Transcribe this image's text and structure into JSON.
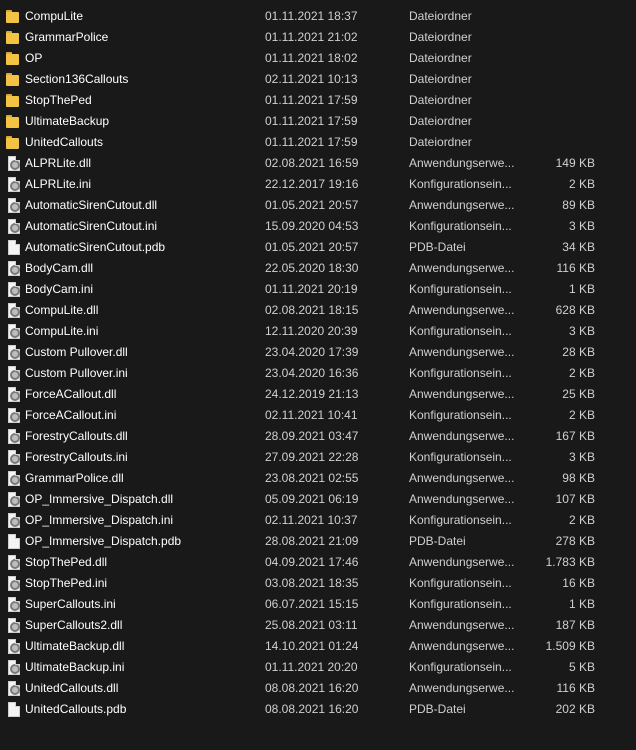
{
  "files": [
    {
      "name": "CompuLite",
      "date": "01.11.2021 18:37",
      "type": "Dateiordner",
      "size": "",
      "icon": "folder-icon"
    },
    {
      "name": "GrammarPolice",
      "date": "01.11.2021 21:02",
      "type": "Dateiordner",
      "size": "",
      "icon": "folder-icon"
    },
    {
      "name": "OP",
      "date": "01.11.2021 18:02",
      "type": "Dateiordner",
      "size": "",
      "icon": "folder-icon"
    },
    {
      "name": "Section136Callouts",
      "date": "02.11.2021 10:13",
      "type": "Dateiordner",
      "size": "",
      "icon": "folder-icon"
    },
    {
      "name": "StopThePed",
      "date": "01.11.2021 17:59",
      "type": "Dateiordner",
      "size": "",
      "icon": "folder-icon"
    },
    {
      "name": "UltimateBackup",
      "date": "01.11.2021 17:59",
      "type": "Dateiordner",
      "size": "",
      "icon": "folder-icon"
    },
    {
      "name": "UnitedCallouts",
      "date": "01.11.2021 17:59",
      "type": "Dateiordner",
      "size": "",
      "icon": "folder-icon"
    },
    {
      "name": "ALPRLite.dll",
      "date": "02.08.2021 16:59",
      "type": "Anwendungserwe...",
      "size": "149 KB",
      "icon": "dll-file-icon"
    },
    {
      "name": "ALPRLite.ini",
      "date": "22.12.2017 19:16",
      "type": "Konfigurationsein...",
      "size": "2 KB",
      "icon": "ini-file-icon"
    },
    {
      "name": "AutomaticSirenCutout.dll",
      "date": "01.05.2021 20:57",
      "type": "Anwendungserwe...",
      "size": "89 KB",
      "icon": "dll-file-icon"
    },
    {
      "name": "AutomaticSirenCutout.ini",
      "date": "15.09.2020 04:53",
      "type": "Konfigurationsein...",
      "size": "3 KB",
      "icon": "ini-file-icon"
    },
    {
      "name": "AutomaticSirenCutout.pdb",
      "date": "01.05.2021 20:57",
      "type": "PDB-Datei",
      "size": "34 KB",
      "icon": "pdb-file-icon"
    },
    {
      "name": "BodyCam.dll",
      "date": "22.05.2020 18:30",
      "type": "Anwendungserwe...",
      "size": "116 KB",
      "icon": "dll-file-icon"
    },
    {
      "name": "BodyCam.ini",
      "date": "01.11.2021 20:19",
      "type": "Konfigurationsein...",
      "size": "1 KB",
      "icon": "ini-file-icon"
    },
    {
      "name": "CompuLite.dll",
      "date": "02.08.2021 18:15",
      "type": "Anwendungserwe...",
      "size": "628 KB",
      "icon": "dll-file-icon"
    },
    {
      "name": "CompuLite.ini",
      "date": "12.11.2020 20:39",
      "type": "Konfigurationsein...",
      "size": "3 KB",
      "icon": "ini-file-icon"
    },
    {
      "name": "Custom Pullover.dll",
      "date": "23.04.2020 17:39",
      "type": "Anwendungserwe...",
      "size": "28 KB",
      "icon": "dll-file-icon"
    },
    {
      "name": "Custom Pullover.ini",
      "date": "23.04.2020 16:36",
      "type": "Konfigurationsein...",
      "size": "2 KB",
      "icon": "ini-file-icon"
    },
    {
      "name": "ForceACallout.dll",
      "date": "24.12.2019 21:13",
      "type": "Anwendungserwe...",
      "size": "25 KB",
      "icon": "dll-file-icon"
    },
    {
      "name": "ForceACallout.ini",
      "date": "02.11.2021 10:41",
      "type": "Konfigurationsein...",
      "size": "2 KB",
      "icon": "ini-file-icon"
    },
    {
      "name": "ForestryCallouts.dll",
      "date": "28.09.2021 03:47",
      "type": "Anwendungserwe...",
      "size": "167 KB",
      "icon": "dll-file-icon"
    },
    {
      "name": "ForestryCallouts.ini",
      "date": "27.09.2021 22:28",
      "type": "Konfigurationsein...",
      "size": "3 KB",
      "icon": "ini-file-icon"
    },
    {
      "name": "GrammarPolice.dll",
      "date": "23.08.2021 02:55",
      "type": "Anwendungserwe...",
      "size": "98 KB",
      "icon": "dll-file-icon"
    },
    {
      "name": "OP_Immersive_Dispatch.dll",
      "date": "05.09.2021 06:19",
      "type": "Anwendungserwe...",
      "size": "107 KB",
      "icon": "dll-file-icon"
    },
    {
      "name": "OP_Immersive_Dispatch.ini",
      "date": "02.11.2021 10:37",
      "type": "Konfigurationsein...",
      "size": "2 KB",
      "icon": "ini-file-icon"
    },
    {
      "name": "OP_Immersive_Dispatch.pdb",
      "date": "28.08.2021 21:09",
      "type": "PDB-Datei",
      "size": "278 KB",
      "icon": "pdb-file-icon"
    },
    {
      "name": "StopThePed.dll",
      "date": "04.09.2021 17:46",
      "type": "Anwendungserwe...",
      "size": "1.783 KB",
      "icon": "dll-file-icon"
    },
    {
      "name": "StopThePed.ini",
      "date": "03.08.2021 18:35",
      "type": "Konfigurationsein...",
      "size": "16 KB",
      "icon": "ini-file-icon"
    },
    {
      "name": "SuperCallouts.ini",
      "date": "06.07.2021 15:15",
      "type": "Konfigurationsein...",
      "size": "1 KB",
      "icon": "ini-file-icon"
    },
    {
      "name": "SuperCallouts2.dll",
      "date": "25.08.2021 03:11",
      "type": "Anwendungserwe...",
      "size": "187 KB",
      "icon": "dll-file-icon"
    },
    {
      "name": "UltimateBackup.dll",
      "date": "14.10.2021 01:24",
      "type": "Anwendungserwe...",
      "size": "1.509 KB",
      "icon": "dll-file-icon"
    },
    {
      "name": "UltimateBackup.ini",
      "date": "01.11.2021 20:20",
      "type": "Konfigurationsein...",
      "size": "5 KB",
      "icon": "ini-file-icon"
    },
    {
      "name": "UnitedCallouts.dll",
      "date": "08.08.2021 16:20",
      "type": "Anwendungserwe...",
      "size": "116 KB",
      "icon": "dll-file-icon"
    },
    {
      "name": "UnitedCallouts.pdb",
      "date": "08.08.2021 16:20",
      "type": "PDB-Datei",
      "size": "202 KB",
      "icon": "pdb-file-icon"
    }
  ]
}
